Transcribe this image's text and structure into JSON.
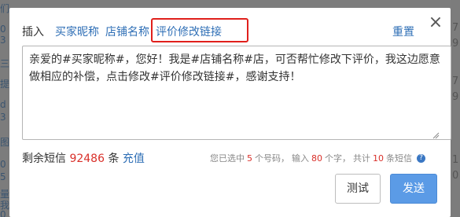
{
  "background": {
    "left_strip_text": [
      "们",
      "0",
      "3",
      "三",
      "提",
      "d",
      "3",
      "图",
      "0",
      "5",
      "量",
      "我",
      "0"
    ],
    "right_numbers": [
      "7",
      "9",
      "7",
      "9",
      "1",
      "0"
    ]
  },
  "dialog": {
    "close_label": "×",
    "insert_label": "插入",
    "insert_links": [
      "买家昵称",
      "店铺名称",
      "评价修改链接"
    ],
    "reset_label": "重置",
    "message": "亲爱的#买家昵称#，您好！我是#店铺名称#店，可否帮忙修改下评价，我这边愿意做相应的补偿，点击修改#评价修改链接#，感谢支持！",
    "remaining_prefix": "剩余短信",
    "remaining_count": "92486",
    "remaining_unit": "条",
    "recharge_label": "充值",
    "stats": {
      "selected_prefix": "您已选中",
      "selected_count": "5",
      "selected_suffix": "个号码，",
      "input_prefix": "输入",
      "input_count": "80",
      "input_suffix": "个字，",
      "total_prefix": "共计",
      "total_count": "10",
      "total_suffix": "条短信"
    },
    "test_button": "测试",
    "send_button": "发送"
  },
  "colors": {
    "link": "#2f6fb6",
    "highlight_box": "#e0201c",
    "count_red": "#d9302a",
    "send_button": "#5b9be6"
  }
}
